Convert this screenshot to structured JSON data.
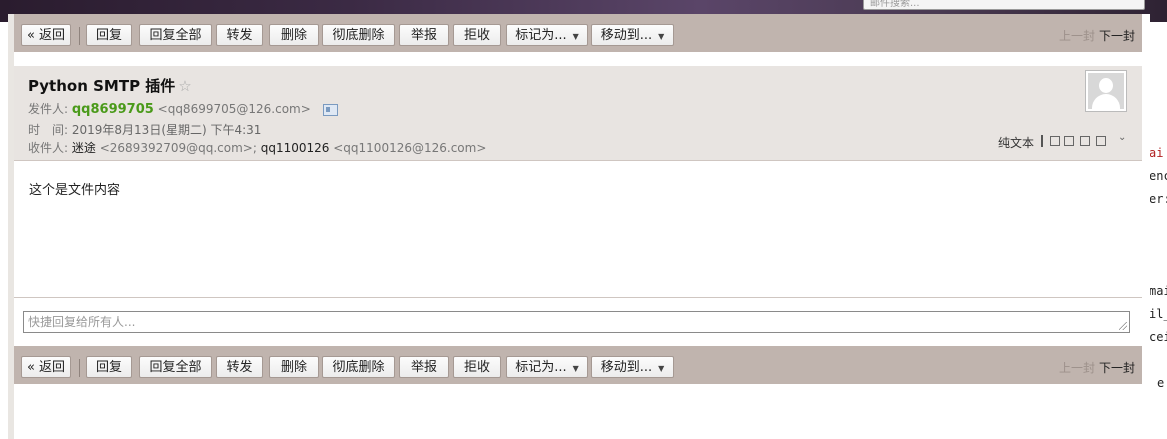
{
  "search": {
    "placeholder": "邮件搜索..."
  },
  "toolbar": {
    "back": "« 返回",
    "reply": "回复",
    "reply_all": "回复全部",
    "forward": "转发",
    "delete": "删除",
    "delete_permanently": "彻底删除",
    "report": "举报",
    "reject": "拒收",
    "mark_as": "标记为...",
    "move_to": "移动到...",
    "prev": "上一封",
    "next": "下一封"
  },
  "message": {
    "subject": "Python SMTP 插件",
    "star": "☆",
    "from_label": "发件人:",
    "from_name": "qq8699705",
    "from_addr": "<qq8699705@126.com>",
    "time_label": "时　间:",
    "time_value": "2019年8月13日(星期二) 下午4:31",
    "to_label": "收件人:",
    "to_1_name": "迷途",
    "to_1_addr": "<2689392709@qq.com>;",
    "to_2_name": "qq1100126",
    "to_2_addr": "<qq1100126@126.com>",
    "plain_text": "纯文本",
    "body": "这个是文件内容"
  },
  "quick_reply": {
    "placeholder": "快捷回复给所有人..."
  },
  "code_strip": [
    "ai",
    "enc",
    "er:",
    "mai",
    "il_",
    "cei",
    "e"
  ],
  "colors": {
    "toolbar_bg": "#c0b4ae",
    "header_bg": "#e8e4e1",
    "sender_green": "#4a9a1a"
  }
}
